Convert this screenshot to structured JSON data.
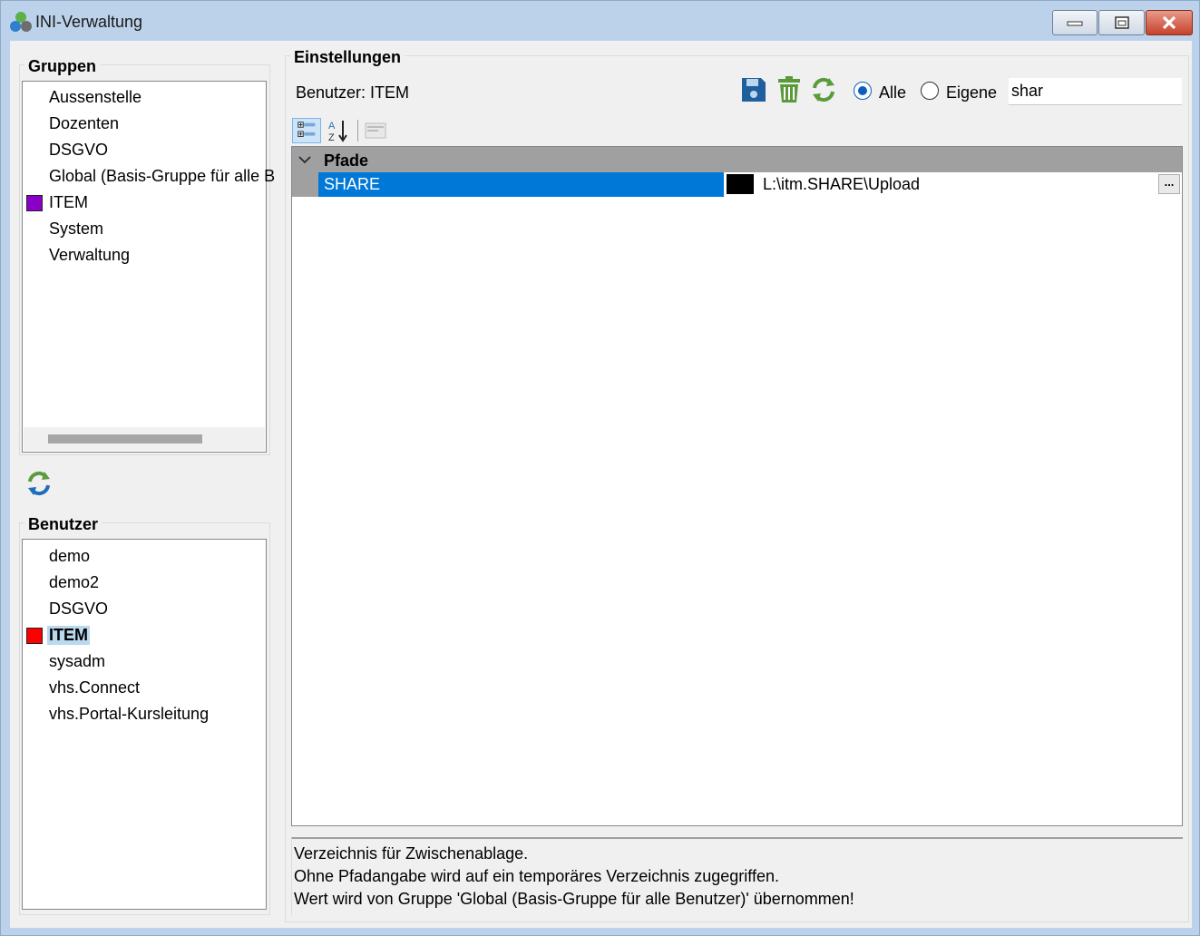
{
  "window": {
    "title": "INI-Verwaltung"
  },
  "groups": {
    "title": "Gruppen",
    "items": [
      {
        "label": "Aussenstelle"
      },
      {
        "label": "Dozenten"
      },
      {
        "label": "DSGVO"
      },
      {
        "label": "Global (Basis-Gruppe für alle B"
      },
      {
        "label": "ITEM",
        "marker_color": "#8b00c9"
      },
      {
        "label": "System"
      },
      {
        "label": "Verwaltung"
      }
    ]
  },
  "users": {
    "title": "Benutzer",
    "selected": "ITEM",
    "items": [
      {
        "label": "demo"
      },
      {
        "label": "demo2"
      },
      {
        "label": "DSGVO"
      },
      {
        "label": "ITEM",
        "marker_color": "#ff0000",
        "selected": true
      },
      {
        "label": "sysadm"
      },
      {
        "label": "vhs.Connect"
      },
      {
        "label": "vhs.Portal-Kursleitung"
      }
    ]
  },
  "settings": {
    "title": "Einstellungen",
    "context_label": "Benutzer: ITEM",
    "toolbar": {
      "save_icon": "save-icon",
      "delete_icon": "trash-icon",
      "refresh_icon": "refresh-icon"
    },
    "filter": {
      "options": [
        {
          "label": "Alle",
          "checked": true
        },
        {
          "label": "Eigene",
          "checked": false
        }
      ]
    },
    "search": {
      "value": "shar"
    },
    "grid": {
      "category": "Pfade",
      "properties": [
        {
          "name": "SHARE",
          "value": "L:\\itm.SHARE\\Upload",
          "color": "#000000",
          "button": "..."
        }
      ]
    },
    "description": {
      "lines": [
        "Verzeichnis für Zwischenablage.",
        "Ohne Pfadangabe wird auf ein temporäres Verzeichnis zugegriffen.",
        "Wert wird von Gruppe 'Global (Basis-Gruppe für alle Benutzer)' übernommen!"
      ]
    }
  },
  "colors": {
    "selection_blue": "#0078d7",
    "accent_green": "#4a9a3a",
    "save_blue": "#1f5f9e"
  }
}
